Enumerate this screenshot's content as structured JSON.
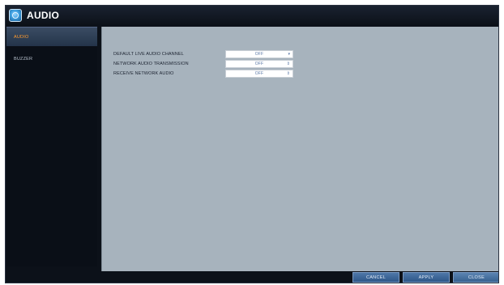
{
  "window": {
    "title": "AUDIO",
    "icon": "app-icon"
  },
  "sidebar": {
    "items": [
      {
        "label": "AUDIO",
        "active": true
      },
      {
        "label": "BUZZER",
        "active": false
      }
    ]
  },
  "settings": [
    {
      "label": "DEFAULT LIVE AUDIO CHANNEL",
      "value": "OFF",
      "arrow": "▾"
    },
    {
      "label": "NETWORK AUDIO TRANSMISSION",
      "value": "OFF",
      "arrow": "⇕"
    },
    {
      "label": "RECEIVE NETWORK AUDIO",
      "value": "OFF",
      "arrow": "⇕"
    }
  ],
  "buttons": {
    "cancel": "CANCEL",
    "apply": "APPLY",
    "close": "CLOSE"
  },
  "colors": {
    "accent": "#ff9a2e",
    "content_bg": "#a7b3bd",
    "button_bg": "#3a6498",
    "value_text": "#5876a6"
  }
}
